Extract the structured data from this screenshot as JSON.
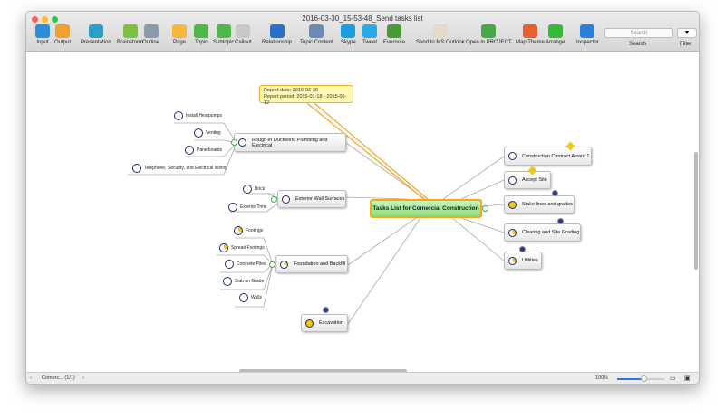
{
  "window": {
    "title": "2016-03-30_15-53-48_Send tasks list"
  },
  "toolbar": [
    {
      "label": "Input",
      "icon": "input-icon",
      "color": "#2a8fd8"
    },
    {
      "label": "Output",
      "icon": "output-icon",
      "color": "#f0a030"
    },
    {
      "label": "Presentation",
      "icon": "presentation-icon",
      "color": "#2aa0c8"
    },
    {
      "label": "Brainstorm",
      "icon": "brainstorm-icon",
      "color": "#7bc043"
    },
    {
      "label": "Outline",
      "icon": "outline-icon",
      "color": "#8a9aa8"
    },
    {
      "label": "Page",
      "icon": "page-icon",
      "color": "#f5b83c"
    },
    {
      "label": "Topic",
      "icon": "topic-icon",
      "color": "#4cb848"
    },
    {
      "label": "Subtopic",
      "icon": "subtopic-icon",
      "color": "#4cb848"
    },
    {
      "label": "Callout",
      "icon": "callout-icon",
      "color": "#c8c8c8"
    },
    {
      "label": "Relationship",
      "icon": "relationship-icon",
      "color": "#2a70c8"
    },
    {
      "label": "Topic Content",
      "icon": "topic-content-icon",
      "color": "#6a8ab8"
    },
    {
      "label": "Skype",
      "icon": "skype-icon",
      "color": "#1a9ee0"
    },
    {
      "label": "Tweet",
      "icon": "tweet-icon",
      "color": "#2aa8e8"
    },
    {
      "label": "Evernote",
      "icon": "evernote-icon",
      "color": "#4a9a3a"
    },
    {
      "label": "Send to MS Outlook",
      "icon": "outlook-icon",
      "color": "#e8d8c8"
    },
    {
      "label": "Open in PROJECT",
      "icon": "project-icon",
      "color": "#48a848"
    },
    {
      "label": "Map Theme",
      "icon": "map-theme-icon",
      "color": "#e86030"
    },
    {
      "label": "Arrange",
      "icon": "arrange-icon",
      "color": "#38b838"
    },
    {
      "label": "Inspector",
      "icon": "inspector-icon",
      "color": "#2a80d8"
    }
  ],
  "search": {
    "placeholder": "Search",
    "label": "Search"
  },
  "filter": {
    "label": "Filter"
  },
  "map": {
    "central": "Tasks List for Comercial Construction",
    "callout": {
      "line1": "Report date: 2016-03-30",
      "line2": "Report period: 2015-01-18 - 2015-06-12"
    },
    "right": [
      "Construction Contract Award 1",
      "Accept Site",
      "Stake lines and grades",
      "Clearing and Site Grading",
      "Utilities"
    ],
    "left": [
      "Rough-in Ductwork, Plumbing and Electrical",
      "Exterior Wall Surfaces",
      "Foundation and Backfill",
      "Excavation"
    ],
    "roughin_children": [
      "Install Heatpumps",
      "Venting",
      "Panelboards",
      "Telephone, Security, and Electrical Wiring"
    ],
    "exterior_children": [
      "Brick",
      "Exterior Trim"
    ],
    "foundation_children": [
      "Footings",
      "Spread Footings",
      "Concrete Piles",
      "Slab on Grade",
      "Walls"
    ]
  },
  "status": {
    "page": "Comerc... (1/1)",
    "zoom": "100%"
  }
}
